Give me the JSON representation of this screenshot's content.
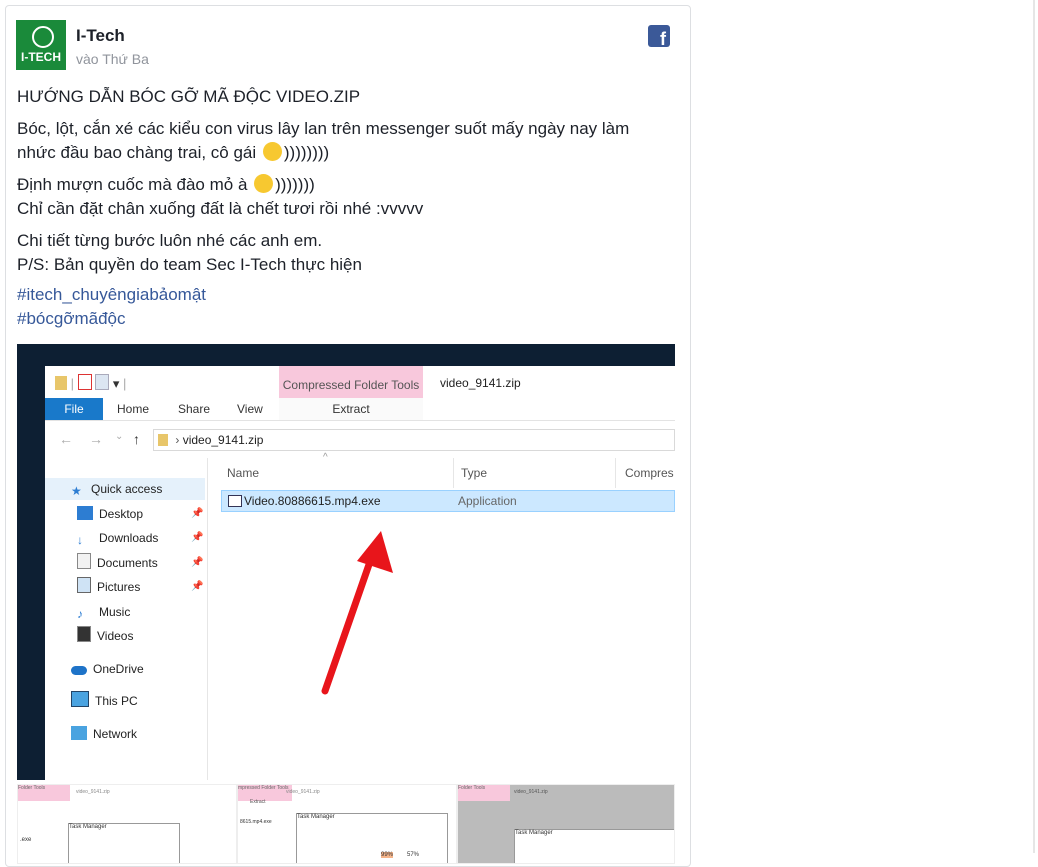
{
  "post": {
    "page_name": "I-Tech",
    "avatar_text": "I-TECH",
    "time": "vào Thứ Ba",
    "title": "HƯỚNG DẪN BÓC GỠ MÃ ĐỘC VIDEO.ZIP",
    "p1_a": "Bóc, lột, cắn xé các kiểu con virus lây lan trên messenger suốt mấy ngày nay làm nhức đầu bao chàng trai, cô gái",
    "p1_b": "))))))))",
    "p2_a": "Định mượn cuốc mà đào mỏ à",
    "p2_b": ")))))))",
    "p2_c": "Chỉ cần đặt chân xuống đất là chết tươi rồi nhé :vvvvv",
    "p3_a": "Chi tiết từng bước luôn nhé các anh em.",
    "p3_b": "P/S: Bản quyền do team Sec I-Tech thực hiện",
    "hashtag1": "#itech_chuyêngiabảomật",
    "hashtag2": "#bócgỡmãđộc",
    "fb_icon": "f"
  },
  "explorer": {
    "context_tab": "Compressed Folder Tools",
    "window_title": "video_9141.zip",
    "tabs": {
      "file": "File",
      "home": "Home",
      "share": "Share",
      "view": "View",
      "extract": "Extract"
    },
    "address": "video_9141.zip",
    "nav": {
      "quick_access": "Quick access",
      "desktop": "Desktop",
      "downloads": "Downloads",
      "documents": "Documents",
      "pictures": "Pictures",
      "music": "Music",
      "videos": "Videos",
      "onedrive": "OneDrive",
      "thispc": "This PC",
      "network": "Network"
    },
    "columns": {
      "name": "Name",
      "type": "Type",
      "compressed": "Compres"
    },
    "file": {
      "name": "Video.80886615.mp4.exe",
      "type": "Application"
    }
  },
  "thumbs": {
    "t1_pink": "Folder Tools",
    "t1_title": "video_9141.zip",
    "t1_exe": ".exe",
    "t1_tm": "Task Manager",
    "t2_pink": "mpressed Folder Tools",
    "t2_title": "video_9141.zip",
    "t2_extract": "Extract",
    "t2_exe": "8615.mp4.exe",
    "t2_tm": "Task Manager",
    "t2_pct1": "99%",
    "t2_pct2": "57%",
    "t3_pink": "Folder Tools",
    "t3_title": "video_9141.zip",
    "t3_tm": "Task Manager"
  }
}
